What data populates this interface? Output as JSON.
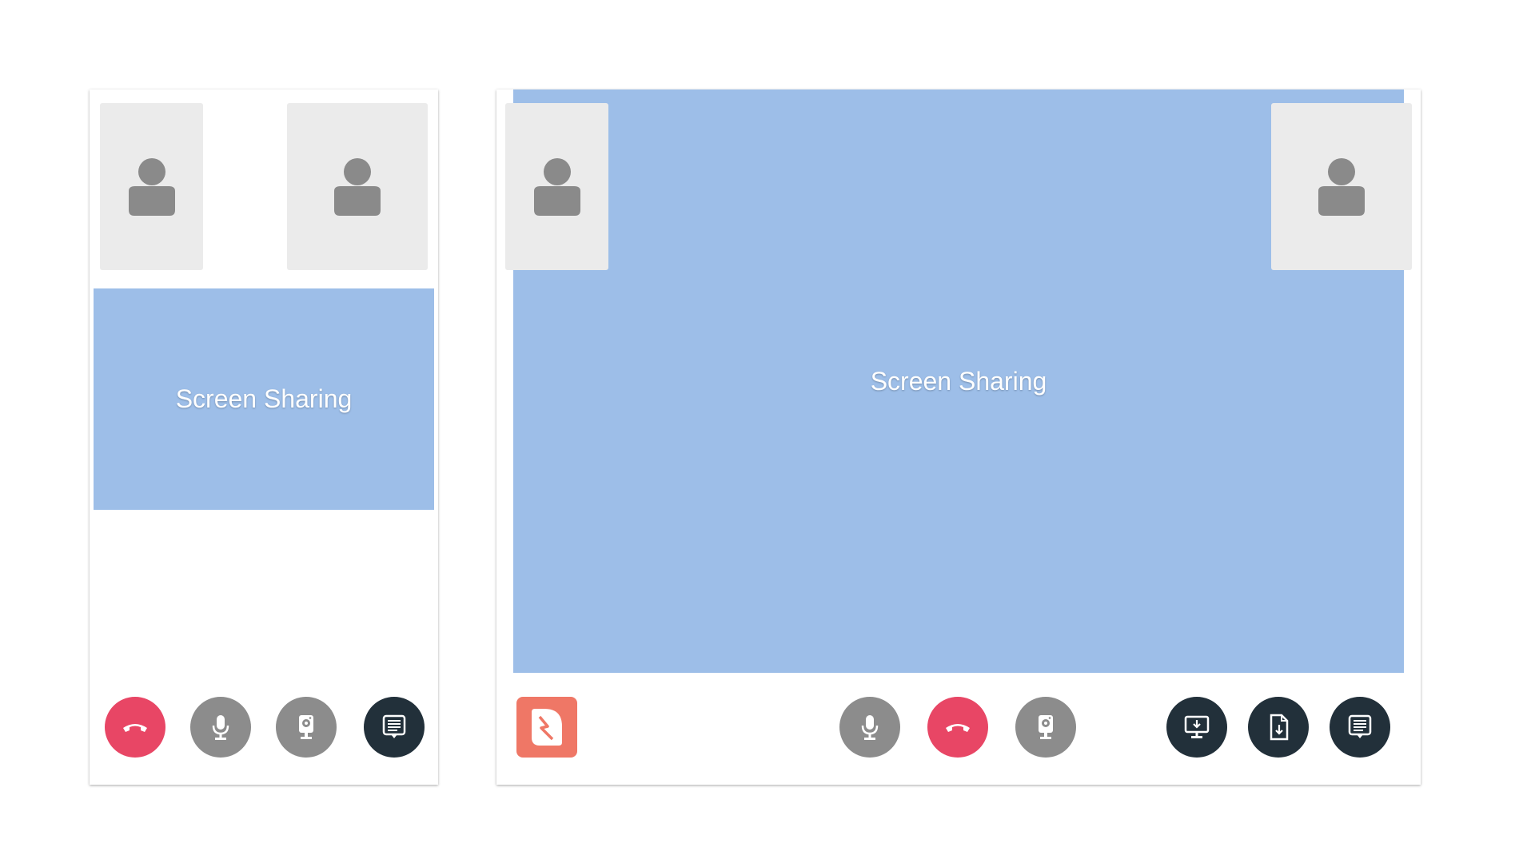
{
  "colors": {
    "tile_bg": "#ebebeb",
    "avatar": "#8a8a8a",
    "share_bg": "#9dbee8",
    "hangup": "#e84665",
    "control_gray": "#8c8c8c",
    "control_dark": "#22303a",
    "logo_bg": "#ef7766"
  },
  "mobile_view": {
    "participants": [
      {
        "icon": "person-icon"
      },
      {
        "icon": "person-icon"
      }
    ],
    "share_label": "Screen Sharing",
    "controls": [
      {
        "icon": "hangup-icon",
        "style": "red"
      },
      {
        "icon": "microphone-icon",
        "style": "gray"
      },
      {
        "icon": "webcam-icon",
        "style": "gray"
      },
      {
        "icon": "chat-icon",
        "style": "dark"
      }
    ]
  },
  "desktop_view": {
    "participants": [
      {
        "icon": "person-icon"
      },
      {
        "icon": "person-icon"
      }
    ],
    "share_label": "Screen Sharing",
    "logo_icon": "app-logo-icon",
    "controls": [
      {
        "icon": "microphone-icon",
        "style": "gray"
      },
      {
        "icon": "hangup-icon",
        "style": "red"
      },
      {
        "icon": "webcam-icon",
        "style": "gray"
      },
      {
        "icon": "screen-share-icon",
        "style": "dark"
      },
      {
        "icon": "file-download-icon",
        "style": "dark"
      },
      {
        "icon": "chat-icon",
        "style": "dark"
      }
    ]
  }
}
